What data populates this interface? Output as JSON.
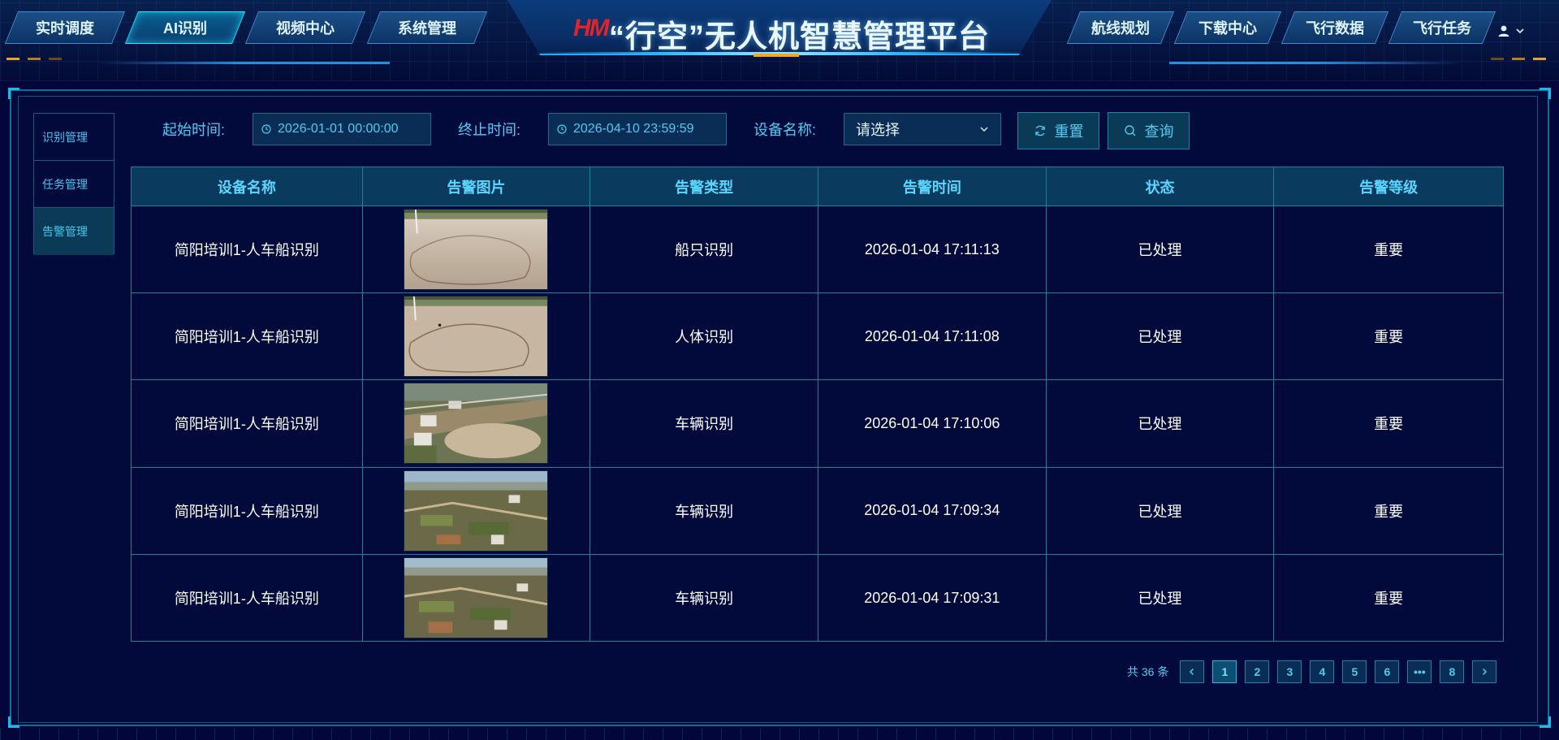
{
  "header": {
    "title": "“行空”无人机智慧管理平台",
    "logo_text": "HM",
    "left_nav": [
      {
        "label": "实时调度",
        "active": false
      },
      {
        "label": "AI识别",
        "active": true
      },
      {
        "label": "视频中心",
        "active": false
      },
      {
        "label": "系统管理",
        "active": false
      }
    ],
    "right_nav": [
      {
        "label": "航线规划"
      },
      {
        "label": "下载中心"
      },
      {
        "label": "飞行数据"
      },
      {
        "label": "飞行任务"
      }
    ]
  },
  "side_menu": [
    {
      "label": "识别管理",
      "active": false
    },
    {
      "label": "任务管理",
      "active": false
    },
    {
      "label": "告警管理",
      "active": true
    }
  ],
  "filters": {
    "start_label": "起始时间:",
    "start_value": "2026-01-01 00:00:00",
    "end_label": "终止时间:",
    "end_value": "2026-04-10 23:59:59",
    "device_label": "设备名称:",
    "device_placeholder": "请选择",
    "reset_label": "重置",
    "search_label": "查询"
  },
  "table": {
    "columns": [
      "设备名称",
      "告警图片",
      "告警类型",
      "告警时间",
      "状态",
      "告警等级"
    ],
    "rows": [
      {
        "device": "简阳培训1-人车船识别",
        "type": "船只识别",
        "time": "2026-01-04 17:11:13",
        "status": "已处理",
        "level": "重要"
      },
      {
        "device": "简阳培训1-人车船识别",
        "type": "人体识别",
        "time": "2026-01-04 17:11:08",
        "status": "已处理",
        "level": "重要"
      },
      {
        "device": "简阳培训1-人车船识别",
        "type": "车辆识别",
        "time": "2026-01-04 17:10:06",
        "status": "已处理",
        "level": "重要"
      },
      {
        "device": "简阳培训1-人车船识别",
        "type": "车辆识别",
        "time": "2026-01-04 17:09:34",
        "status": "已处理",
        "level": "重要"
      },
      {
        "device": "简阳培训1-人车船识别",
        "type": "车辆识别",
        "time": "2026-01-04 17:09:31",
        "status": "已处理",
        "level": "重要"
      }
    ]
  },
  "pagination": {
    "total_text": "共 36 条",
    "pages": [
      "1",
      "2",
      "3",
      "4",
      "5",
      "6",
      "•••",
      "8"
    ],
    "current": "1"
  },
  "colors": {
    "background": "#02063a",
    "accent": "#4ecbf2",
    "header_text": "#5ad6ff",
    "border": "#1e7f98"
  }
}
